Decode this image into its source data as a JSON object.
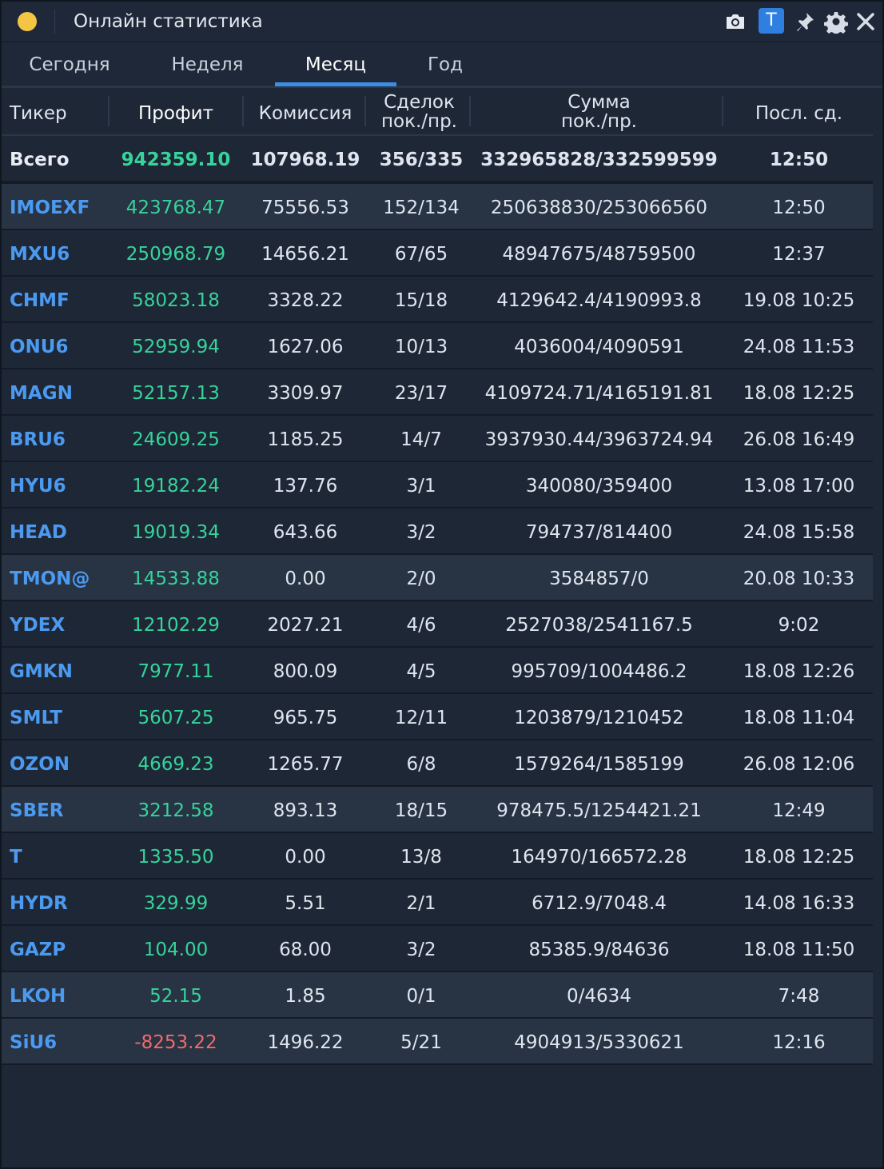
{
  "window": {
    "title": "Онлайн статистика",
    "toolbar": {
      "t_label": "T"
    }
  },
  "tabs": [
    "Сегодня",
    "Неделя",
    "Месяц",
    "Год"
  ],
  "active_tab": "Месяц",
  "columns": {
    "ticker": "Тикер",
    "profit": "Профит",
    "fee": "Комиссия",
    "deals_1": "Сделок",
    "deals_2": "пок./пр.",
    "sum_1": "Сумма",
    "sum_2": "пок./пр.",
    "last": "Посл. сд."
  },
  "total": {
    "ticker": "Всего",
    "profit": "942359.10",
    "fee": "107968.19",
    "deals": "356/335",
    "sum": "332965828/332599599",
    "last": "12:50"
  },
  "rows": [
    {
      "ticker": "IMOEXF",
      "profit": "423768.47",
      "fee": "75556.53",
      "deals": "152/134",
      "sum": "250638830/253066560",
      "last": "12:50"
    },
    {
      "ticker": "MXU6",
      "profit": "250968.79",
      "fee": "14656.21",
      "deals": "67/65",
      "sum": "48947675/48759500",
      "last": "12:37"
    },
    {
      "ticker": "CHMF",
      "profit": "58023.18",
      "fee": "3328.22",
      "deals": "15/18",
      "sum": "4129642.4/4190993.8",
      "last": "19.08 10:25"
    },
    {
      "ticker": "ONU6",
      "profit": "52959.94",
      "fee": "1627.06",
      "deals": "10/13",
      "sum": "4036004/4090591",
      "last": "24.08 11:53"
    },
    {
      "ticker": "MAGN",
      "profit": "52157.13",
      "fee": "3309.97",
      "deals": "23/17",
      "sum": "4109724.71/4165191.81",
      "last": "18.08 12:25"
    },
    {
      "ticker": "BRU6",
      "profit": "24609.25",
      "fee": "1185.25",
      "deals": "14/7",
      "sum": "3937930.44/3963724.94",
      "last": "26.08 16:49"
    },
    {
      "ticker": "HYU6",
      "profit": "19182.24",
      "fee": "137.76",
      "deals": "3/1",
      "sum": "340080/359400",
      "last": "13.08 17:00"
    },
    {
      "ticker": "HEAD",
      "profit": "19019.34",
      "fee": "643.66",
      "deals": "3/2",
      "sum": "794737/814400",
      "last": "24.08 15:58"
    },
    {
      "ticker": "TMON@",
      "profit": "14533.88",
      "fee": "0.00",
      "deals": "2/0",
      "sum": "3584857/0",
      "last": "20.08 10:33"
    },
    {
      "ticker": "YDEX",
      "profit": "12102.29",
      "fee": "2027.21",
      "deals": "4/6",
      "sum": "2527038/2541167.5",
      "last": "9:02"
    },
    {
      "ticker": "GMKN",
      "profit": "7977.11",
      "fee": "800.09",
      "deals": "4/5",
      "sum": "995709/1004486.2",
      "last": "18.08 12:26"
    },
    {
      "ticker": "SMLT",
      "profit": "5607.25",
      "fee": "965.75",
      "deals": "12/11",
      "sum": "1203879/1210452",
      "last": "18.08 11:04"
    },
    {
      "ticker": "OZON",
      "profit": "4669.23",
      "fee": "1265.77",
      "deals": "6/8",
      "sum": "1579264/1585199",
      "last": "26.08 12:06"
    },
    {
      "ticker": "SBER",
      "profit": "3212.58",
      "fee": "893.13",
      "deals": "18/15",
      "sum": "978475.5/1254421.21",
      "last": "12:49"
    },
    {
      "ticker": "T",
      "profit": "1335.50",
      "fee": "0.00",
      "deals": "13/8",
      "sum": "164970/166572.28",
      "last": "18.08 12:25"
    },
    {
      "ticker": "HYDR",
      "profit": "329.99",
      "fee": "5.51",
      "deals": "2/1",
      "sum": "6712.9/7048.4",
      "last": "14.08 16:33"
    },
    {
      "ticker": "GAZP",
      "profit": "104.00",
      "fee": "68.00",
      "deals": "3/2",
      "sum": "85385.9/84636",
      "last": "18.08 11:50"
    },
    {
      "ticker": "LKOH",
      "profit": "52.15",
      "fee": "1.85",
      "deals": "0/1",
      "sum": "0/4634",
      "last": "7:48"
    },
    {
      "ticker": "SiU6",
      "profit": "-8253.22",
      "fee": "1496.22",
      "deals": "5/21",
      "sum": "4904913/5330621",
      "last": "12:16"
    }
  ],
  "highlighted_tickers": [
    "IMOEXF",
    "TMON@",
    "SBER",
    "LKOH",
    "SiU6"
  ],
  "colors": {
    "accent": "#3a8ee8",
    "profit_positive": "#36d39a",
    "profit_negative": "#f06b6b",
    "ticker": "#4c9af0",
    "background": "#1e2736"
  }
}
